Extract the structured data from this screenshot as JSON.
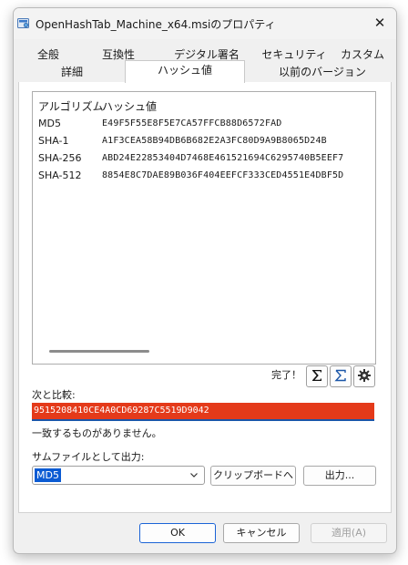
{
  "window": {
    "title": "OpenHashTab_Machine_x64.msiのプロパティ",
    "close_symbol": "✕"
  },
  "tabs": {
    "row1": [
      "全般",
      "互換性",
      "デジタル署名",
      "セキュリティ",
      "カスタム"
    ],
    "row2": [
      "詳細",
      "ハッシュ値",
      "以前のバージョン"
    ],
    "selected": "ハッシュ値"
  },
  "hash_list": {
    "columns": [
      "アルゴリズム",
      "ハッシュ値"
    ],
    "rows": [
      {
        "algorithm": "MD5",
        "hash": "E49F5F55E8F5E7CA57FFCB88D6572FAD"
      },
      {
        "algorithm": "SHA-1",
        "hash": "A1F3CEA58B94DB6B682E2A3FC80D9A9B8065D24B"
      },
      {
        "algorithm": "SHA-256",
        "hash": "ABD24E22853404D7468E461521694C6295740B5EEF7"
      },
      {
        "algorithm": "SHA-512",
        "hash": "8854E8C7DAE89B036F404EEFCF333CED4551E4DBF5D"
      }
    ]
  },
  "status": {
    "done_text": "完了！"
  },
  "icons": {
    "sum": "sigma-icon",
    "sum_outline": "sigma-outline-icon",
    "settings": "gear-icon"
  },
  "compare": {
    "label": "次と比較:",
    "value": "9515208410CE4A0CD69287C5519D9042",
    "result": "一致するものがありません。"
  },
  "export": {
    "label": "サムファイルとして出力:",
    "selected_algorithm": "MD5",
    "clipboard_button": "クリップボードへ",
    "output_button": "出力..."
  },
  "footer": {
    "ok": "OK",
    "cancel": "キャンセル",
    "apply": "適用(A)"
  },
  "colors": {
    "mismatch": "#e43a1a",
    "selection": "#0b5bd3",
    "focus_border": "#1b56a8"
  }
}
